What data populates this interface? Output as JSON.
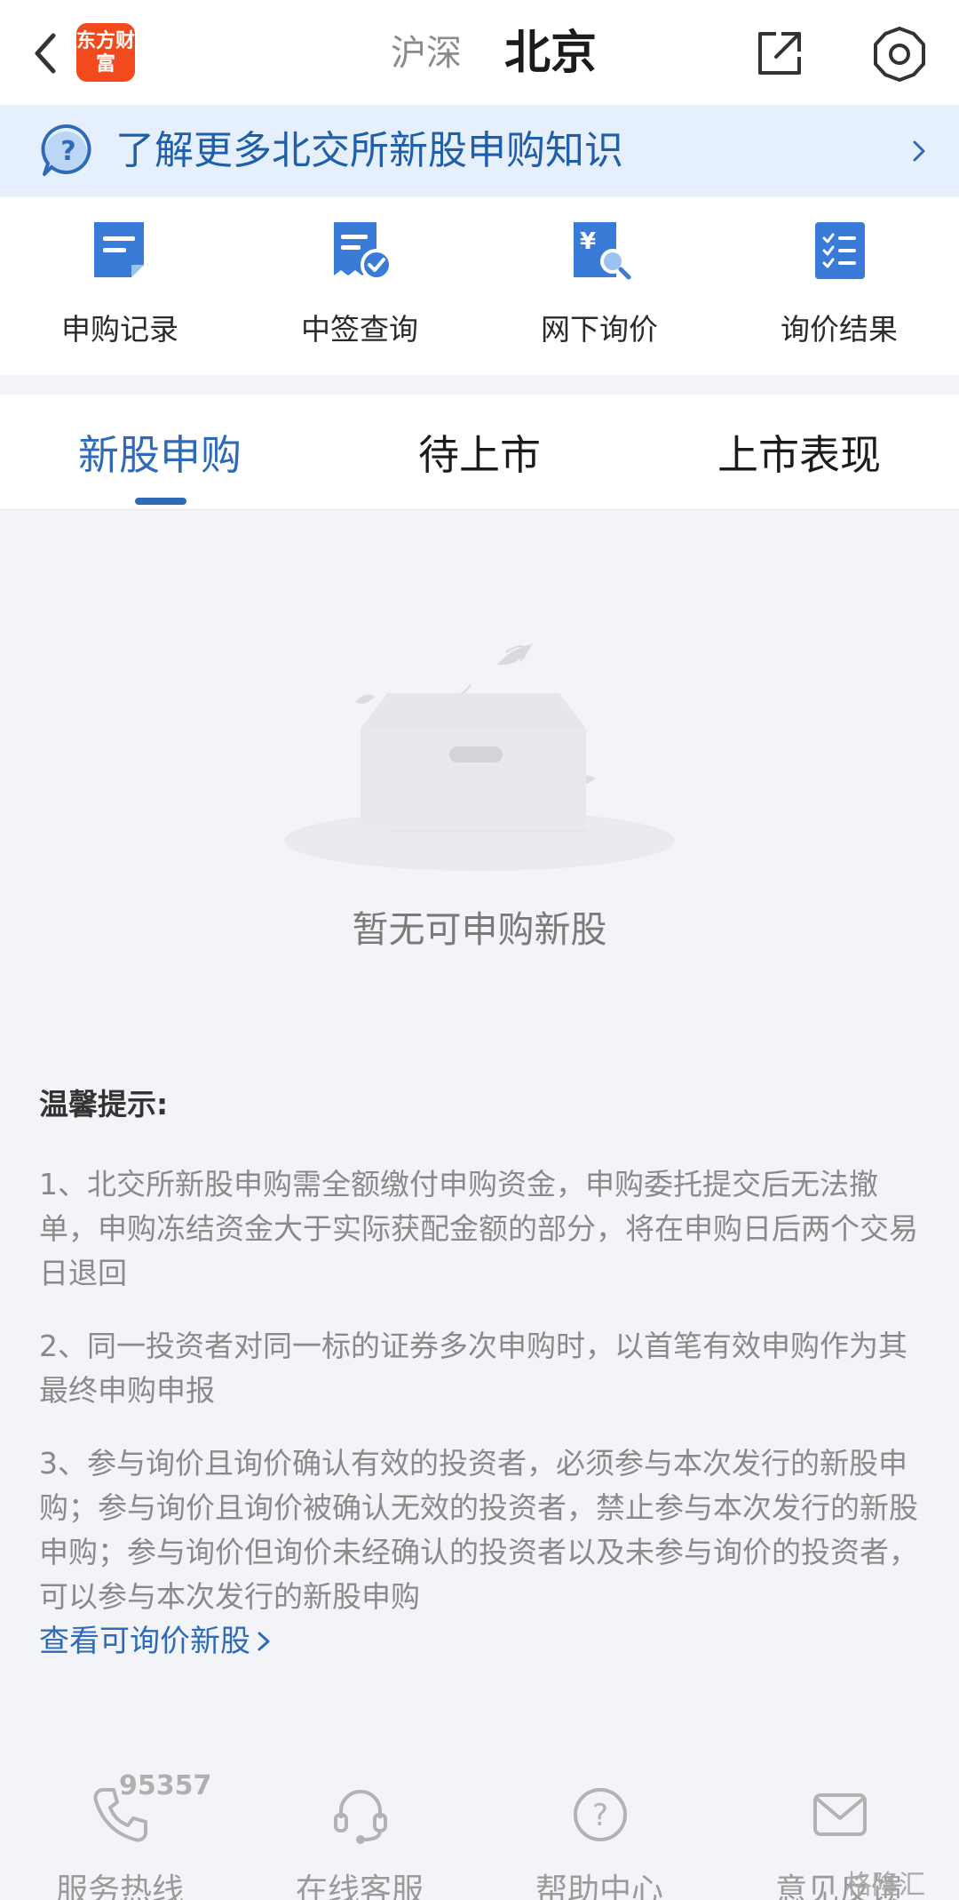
{
  "header": {
    "logo_text": "东方财富",
    "market_tabs": [
      "沪深",
      "北京"
    ],
    "active_market": "北京",
    "icons": [
      "back-arrow-icon",
      "share-external-icon",
      "gear-icon"
    ]
  },
  "banner": {
    "text": "了解更多北交所新股申购知识",
    "icon": "question-bubble-icon"
  },
  "quick_entries": [
    {
      "label": "申购记录",
      "icon": "document-record-icon"
    },
    {
      "label": "中签查询",
      "icon": "receipt-check-icon"
    },
    {
      "label": "网下询价",
      "icon": "yen-search-icon"
    },
    {
      "label": "询价结果",
      "icon": "checklist-icon"
    }
  ],
  "tabs": [
    "新股申购",
    "待上市",
    "上市表现"
  ],
  "active_tab": "新股申购",
  "empty_state": {
    "text": "暂无可申购新股",
    "icon": "empty-box-icon"
  },
  "tips": {
    "title": "温馨提示:",
    "items": [
      "1、北交所新股申购需全额缴付申购资金，申购委托提交后无法撤单，申购冻结资金大于实际获配金额的部分，将在申购日后两个交易日退回",
      "2、同一投资者对同一标的证券多次申购时，以首笔有效申购作为其最终申购申报",
      "3、参与询价且询价确认有效的投资者，必须参与本次发行的新股申购；参与询价且询价被确认无效的投资者，禁止参与本次发行的新股申购；参与询价但询价未经确认的投资者以及未参与询价的投资者，可以参与本次发行的新股申购"
    ],
    "link": "查看可询价新股"
  },
  "services": [
    {
      "label": "服务热线",
      "icon": "phone-icon",
      "extra": "95357"
    },
    {
      "label": "在线客服",
      "icon": "headset-icon"
    },
    {
      "label": "帮助中心",
      "icon": "help-circle-icon"
    },
    {
      "label": "意见反馈",
      "icon": "mail-icon"
    }
  ],
  "watermark": "格隆汇",
  "colors": {
    "accent": "#2f6ab8",
    "banner_bg": "#e6f0fd",
    "logo_bg": "#f24a1d",
    "page_bg": "#f3f4f8"
  }
}
